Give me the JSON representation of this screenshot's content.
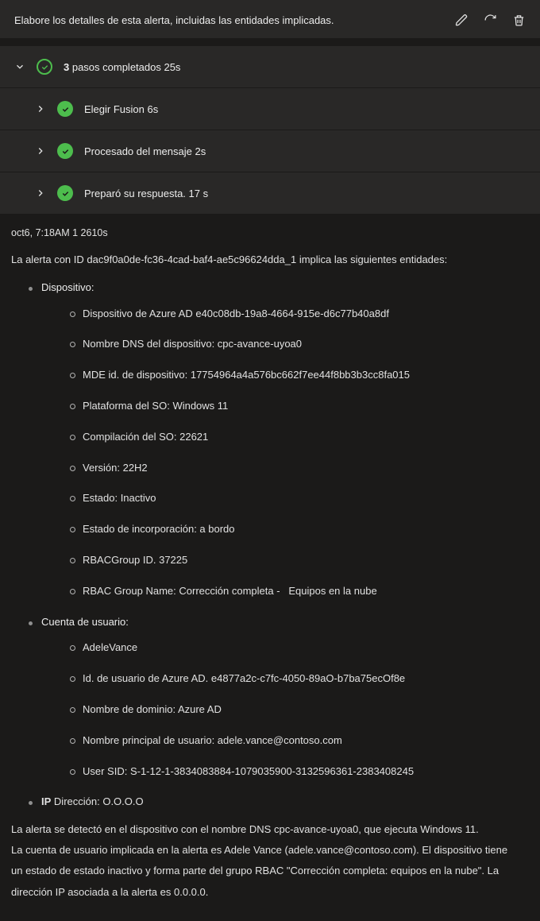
{
  "header": {
    "prompt": "Elabore los detalles de esta alerta, incluidas las entidades implicadas."
  },
  "steps": {
    "summary_prefix": "3",
    "summary_rest": " pasos completados 25s",
    "items": [
      {
        "text": "Elegir Fusion 6s"
      },
      {
        "text": "Procesado del mensaje 2s"
      },
      {
        "text": "Preparó su respuesta. 17 s"
      }
    ]
  },
  "body": {
    "timestamp": "oct6, 7:18AM 1 2610s",
    "lead": "La alerta con ID dac9f0a0de-fc36-4cad-baf4-ae5c96624dda_1 implica las siguientes entidades:",
    "device": {
      "title": "Dispositivo:",
      "items": [
        "Dispositivo de Azure AD e40c08db-19a8-4664-915e-d6c77b40a8df",
        "Nombre DNS del dispositivo: cpc-avance-uyoa0",
        "MDE id. de dispositivo: 17754964a4a576bc662f7ee44f8bb3b3cc8fa015",
        "Plataforma del SO: Windows 11",
        "Compilación del SO: 22621",
        "Versión: 22H2",
        "Estado: Inactivo",
        "Estado de incorporación: a bordo",
        "RBACGroup ID. 37225",
        "RBAC Group Name: Corrección completa -   Equipos en la nube"
      ]
    },
    "user": {
      "title": "Cuenta de usuario:",
      "items": [
        "AdeleVance",
        "Id. de usuario de Azure AD. e4877a2c-c7fc-4050-89aO-b7ba75ecOf8e",
        "Nombre de dominio: Azure AD",
        "Nombre principal de usuario: adele.vance@contoso.com",
        "User SID: S-1-12-1-3834083884-1079035900-3132596361-2383408245"
      ]
    },
    "ip": {
      "label": "IP",
      "value": "Dirección: O.O.O.O"
    },
    "summary": [
      "La alerta se detectó en el dispositivo con el nombre DNS cpc-avance-uyoa0, que ejecuta Windows 11.",
      "La cuenta de usuario implicada en la alerta es Adele Vance (adele.vance@contoso.com). El dispositivo tiene",
      "un estado de estado inactivo y forma parte del grupo RBAC \"Corrección completa: equipos en la nube\". La",
      "dirección IP asociada a la alerta es 0.0.0.0."
    ]
  }
}
